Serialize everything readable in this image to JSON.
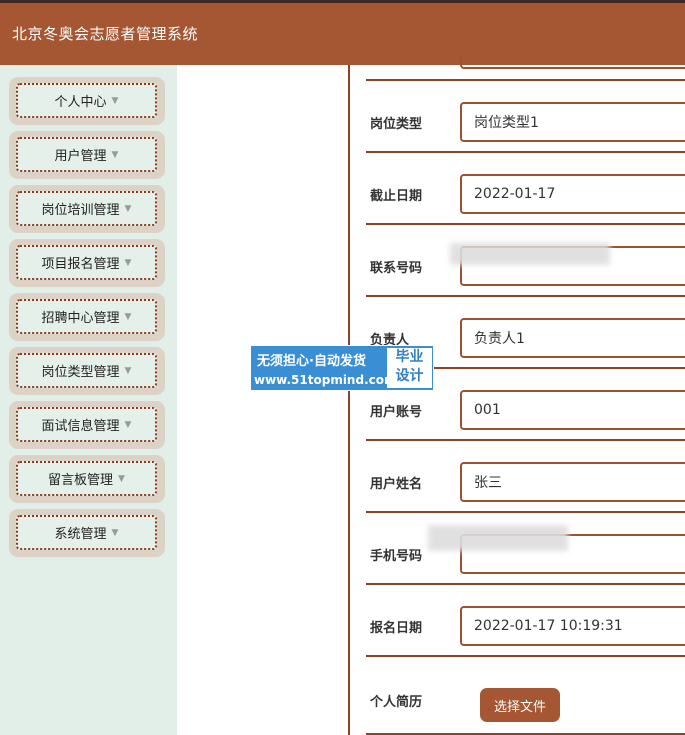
{
  "app": {
    "title": "北京冬奥会志愿者管理系统"
  },
  "sidebar": {
    "items": [
      {
        "label": "个人中心"
      },
      {
        "label": "用户管理"
      },
      {
        "label": "岗位培训管理"
      },
      {
        "label": "项目报名管理"
      },
      {
        "label": "招聘中心管理"
      },
      {
        "label": "岗位类型管理"
      },
      {
        "label": "面试信息管理"
      },
      {
        "label": "留言板管理"
      },
      {
        "label": "系统管理"
      }
    ]
  },
  "form": {
    "position_type": {
      "label": "岗位类型",
      "value": "岗位类型1"
    },
    "deadline": {
      "label": "截止日期",
      "value": "2022-01-17"
    },
    "contact_phone": {
      "label": "联系号码",
      "value": ""
    },
    "manager": {
      "label": "负责人",
      "value": "负责人1"
    },
    "user_account": {
      "label": "用户账号",
      "value": "001"
    },
    "user_name": {
      "label": "用户姓名",
      "value": "张三"
    },
    "mobile": {
      "label": "手机号码",
      "value": ""
    },
    "signup_date": {
      "label": "报名日期",
      "value": "2022-01-17 10:19:31"
    },
    "resume": {
      "label": "个人简历",
      "button": "选择文件"
    }
  },
  "watermark": {
    "line1": "无须担心·自动发货",
    "line2": "www.51topmind.com",
    "badge1": "毕业",
    "badge2": "设计"
  },
  "colors": {
    "header": "#a55633",
    "sidebar_bg": "#e1efe8",
    "border": "#9c5131",
    "watermark": "#3a8fd4"
  }
}
